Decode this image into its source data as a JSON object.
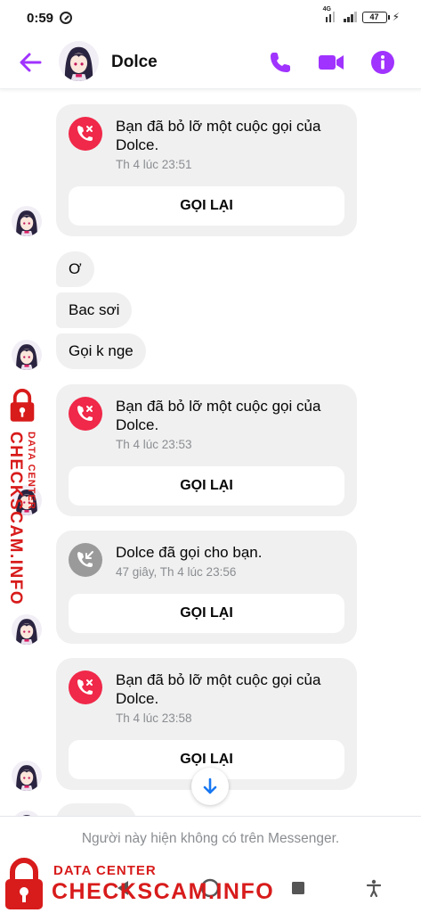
{
  "status_bar": {
    "time": "0:59",
    "network": "4G",
    "battery": "47"
  },
  "header": {
    "contact_name": "Dolce"
  },
  "colors": {
    "accent": "#a033ff",
    "missed_call": "#f02849",
    "incoming_call": "#9a9a9a",
    "bubble": "#f0f0f0",
    "watermark": "#d81b1b"
  },
  "icons": {
    "back": "arrow-left-icon",
    "call": "phone-icon",
    "video": "video-camera-icon",
    "info": "info-icon",
    "missed": "missed-call-icon",
    "incoming": "incoming-call-icon",
    "scroll": "arrow-down-icon"
  },
  "messages": [
    {
      "type": "call",
      "kind": "missed",
      "title": "Bạn đã bỏ lỡ một cuộc gọi của Dolce.",
      "time": "Th 4 lúc 23:51",
      "button": "GỌI LẠI"
    },
    {
      "type": "text",
      "text": "Ơ"
    },
    {
      "type": "text",
      "text": "Bac sơi"
    },
    {
      "type": "text",
      "text": "Gọi k nge"
    },
    {
      "type": "call",
      "kind": "missed",
      "title": "Bạn đã bỏ lỡ một cuộc gọi của Dolce.",
      "time": "Th 4 lúc 23:53",
      "button": "GỌI LẠI"
    },
    {
      "type": "call",
      "kind": "incoming",
      "title": "Dolce đã gọi cho bạn.",
      "time": "47 giây, Th 4 lúc 23:56",
      "button": "GỌI LẠI"
    },
    {
      "type": "call",
      "kind": "missed",
      "title": "Bạn đã bỏ lỡ một cuộc gọi của Dolce.",
      "time": "Th 4 lúc 23:58",
      "button": "GỌI LẠI"
    }
  ],
  "footer": {
    "notice": "Người này hiện không có trên Messenger."
  },
  "watermark": {
    "small": "DATA CENTER",
    "big": "CHECKSCAM.INFO"
  }
}
